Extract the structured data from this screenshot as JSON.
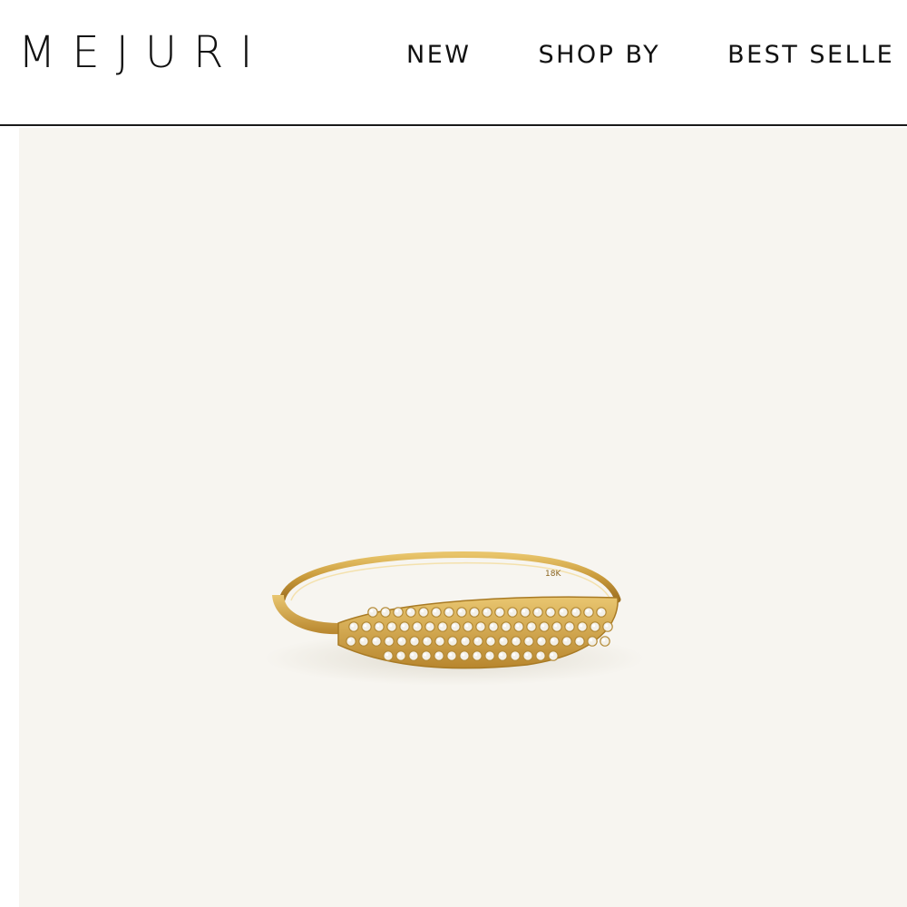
{
  "header": {
    "logo": "MEJURI",
    "nav": [
      {
        "label": "NEW"
      },
      {
        "label": "SHOP BY"
      },
      {
        "label": "BEST SELLE"
      }
    ]
  },
  "product_image": {
    "subject": "gold-ring-icon",
    "engraving": "18K",
    "colors": {
      "background": "#f7f5f0",
      "gold": "#d4a94a",
      "gold_dark": "#a87a24",
      "diamond": "#f3f0e8"
    }
  }
}
